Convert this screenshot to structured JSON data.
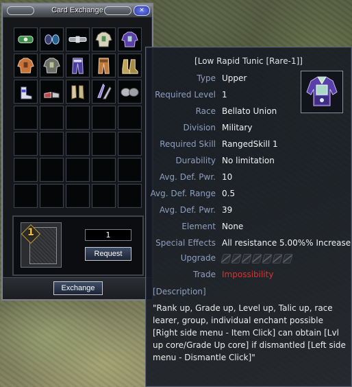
{
  "window": {
    "title": "Card Exchange",
    "close_label": "×",
    "quantity": "1",
    "request_label": "Request",
    "exchange_label": "Exchange",
    "card_number": "1"
  },
  "inventory": {
    "items": [
      {
        "icon": "bracelet-icon"
      },
      {
        "icon": "earring-icon"
      },
      {
        "icon": "belt-icon"
      },
      {
        "icon": "armor-white-icon"
      },
      {
        "icon": "armor-purple-icon"
      },
      {
        "icon": "armor-orange-icon"
      },
      {
        "icon": "armor-grey-icon"
      },
      {
        "icon": "pants-purple-icon"
      },
      {
        "icon": "pants-orange-icon"
      },
      {
        "icon": "boots-gold-icon"
      },
      {
        "icon": "boots-white-icon"
      },
      {
        "icon": "shoes-red-icon"
      },
      {
        "icon": "gloves-icon"
      },
      {
        "icon": "claw-icon"
      },
      {
        "icon": "shoulder-icon"
      }
    ],
    "empty_slots": 20
  },
  "tooltip": {
    "title": "[Low Rapid Tunic [Rare-1]]",
    "item_icon": "tunic-purple-icon",
    "rows": [
      {
        "label": "Type",
        "value": "Upper"
      },
      {
        "label": "Required Level",
        "value": "1"
      },
      {
        "label": "Race",
        "value": "Bellato Union"
      },
      {
        "label": "Division",
        "value": "Military"
      },
      {
        "label": "Required Skill",
        "value": "RangedSkill 1"
      },
      {
        "label": "Durability",
        "value": "No limitation"
      },
      {
        "label": "Avg. Def. Pwr.",
        "value": "10"
      },
      {
        "label": "Avg. Def. Range",
        "value": "0.5"
      },
      {
        "label": "Avg. Def. Pwr.",
        "value": "39"
      },
      {
        "label": "Element",
        "value": "None"
      },
      {
        "label": "Special Effects",
        "value": "All resistance 5.00%% Increase"
      }
    ],
    "upgrade_label": "Upgrade",
    "upgrade_slots": 7,
    "trade_label": "Trade",
    "trade_value": "Impossibility",
    "description_label": "[Description]",
    "description": "\"Rank up, Grade up, Level up, Talic up, race learer, group, individual enchant possible [Right side menu - Item Click] can obtain [Lvl up core/Grade Up core] if dismantled [Left side menu - Dismantle Click]\""
  },
  "colors": {
    "label": "#8e9fc0",
    "value": "#f1f1f1",
    "warning": "#e0312c",
    "card_number": "#f4c531"
  }
}
